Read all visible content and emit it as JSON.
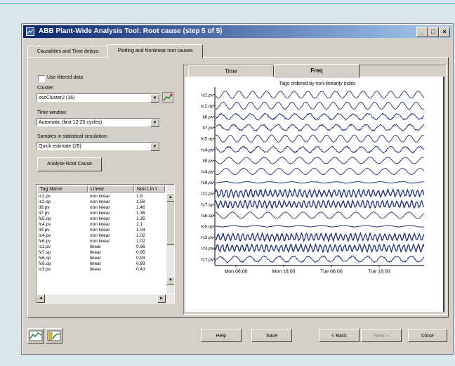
{
  "window": {
    "title": "ABB Plant-Wide Analysis Tool: Root cause (step 5 of 5)"
  },
  "title_buttons": {
    "minimize": "_",
    "maximize": "□",
    "close": "×"
  },
  "main_tabs": [
    {
      "label": "Causalities and Time delays"
    },
    {
      "label": "Plotting and Nonlinear root causes"
    }
  ],
  "left": {
    "use_filtered_label": "Use filtered data",
    "cluster_label": "Cluster:",
    "cluster_value": "oscCluster2  (16)",
    "time_window_label": "Time window:",
    "time_window_value": "Automatic (first 12-25 cycles)",
    "samples_label": "Samples in statistical simulation:",
    "samples_value": "Quick estimate (25)",
    "analyse_button": "Analyse Root Cause",
    "table_headers": [
      "Tag Name",
      "Linear",
      "Non Lin I"
    ],
    "table_rows": [
      [
        "lc2.pv",
        "non linear",
        "1.8"
      ],
      [
        "lc2.op",
        "non linear",
        "1.56"
      ],
      [
        "ti8.pv",
        "non linear",
        "1.46"
      ],
      [
        "ti7.pv",
        "non linear",
        "1.36"
      ],
      [
        "fc5.op",
        "non linear",
        "1.35"
      ],
      [
        "fc4.pv",
        "non linear",
        "1.1"
      ],
      [
        "ti9.pv",
        "non linear",
        "1.04"
      ],
      [
        "tc4.pv",
        "non linear",
        "1.02"
      ],
      [
        "fc6.pv",
        "non linear",
        "1.02"
      ],
      [
        "lc1.pv",
        "linear",
        "0.96"
      ],
      [
        "fc7.sp",
        "linear",
        "0.95"
      ],
      [
        "fc6.sp",
        "linear",
        "0.93"
      ],
      [
        "fc6.op",
        "linear",
        "0.89"
      ],
      [
        "lc3.pv",
        "linear",
        "0.43"
      ]
    ]
  },
  "plot_tabs": [
    {
      "label": "Time"
    },
    {
      "label": "Freq"
    }
  ],
  "chart_data": {
    "type": "line",
    "title": "Tags ordered by non-linearity index",
    "xlabel": "",
    "ylabel": "",
    "x_ticks": [
      "Mon 06:00",
      "Mon 18:00",
      "Tue 06:00",
      "Tue 18:00"
    ],
    "series": [
      {
        "name": "lc2.pv",
        "style": "smooth-fast"
      },
      {
        "name": "lc2.op",
        "style": "smooth-fast"
      },
      {
        "name": "ti8.pv",
        "style": "noisy"
      },
      {
        "name": "ti7.pv",
        "style": "noisy"
      },
      {
        "name": "fc5.op",
        "style": "smooth-fast"
      },
      {
        "name": "fc4.pv",
        "style": "noisy"
      },
      {
        "name": "ti9.pv",
        "style": "smooth"
      },
      {
        "name": "tc4.pv",
        "style": "smooth"
      },
      {
        "name": "fc6.pv",
        "style": "flat"
      },
      {
        "name": "lc1.pv",
        "style": "dense"
      },
      {
        "name": "fc7.sp",
        "style": "dense"
      },
      {
        "name": "fc6.sp",
        "style": "smooth"
      },
      {
        "name": "fc6.op",
        "style": "flat"
      },
      {
        "name": "lc3.pv",
        "style": "dense"
      },
      {
        "name": "lc3.pv",
        "style": "dense"
      },
      {
        "name": "fc7.pv",
        "style": "noisy"
      }
    ],
    "line_color": "#1f2f7a"
  },
  "bottom_buttons": {
    "help": "Help",
    "save": "Save",
    "back": "< Back",
    "next": "Next >",
    "close": "Close"
  },
  "colors": {
    "title_start": "#0a2470",
    "title_end": "#a6caf0",
    "background": "#d9e6ec"
  }
}
